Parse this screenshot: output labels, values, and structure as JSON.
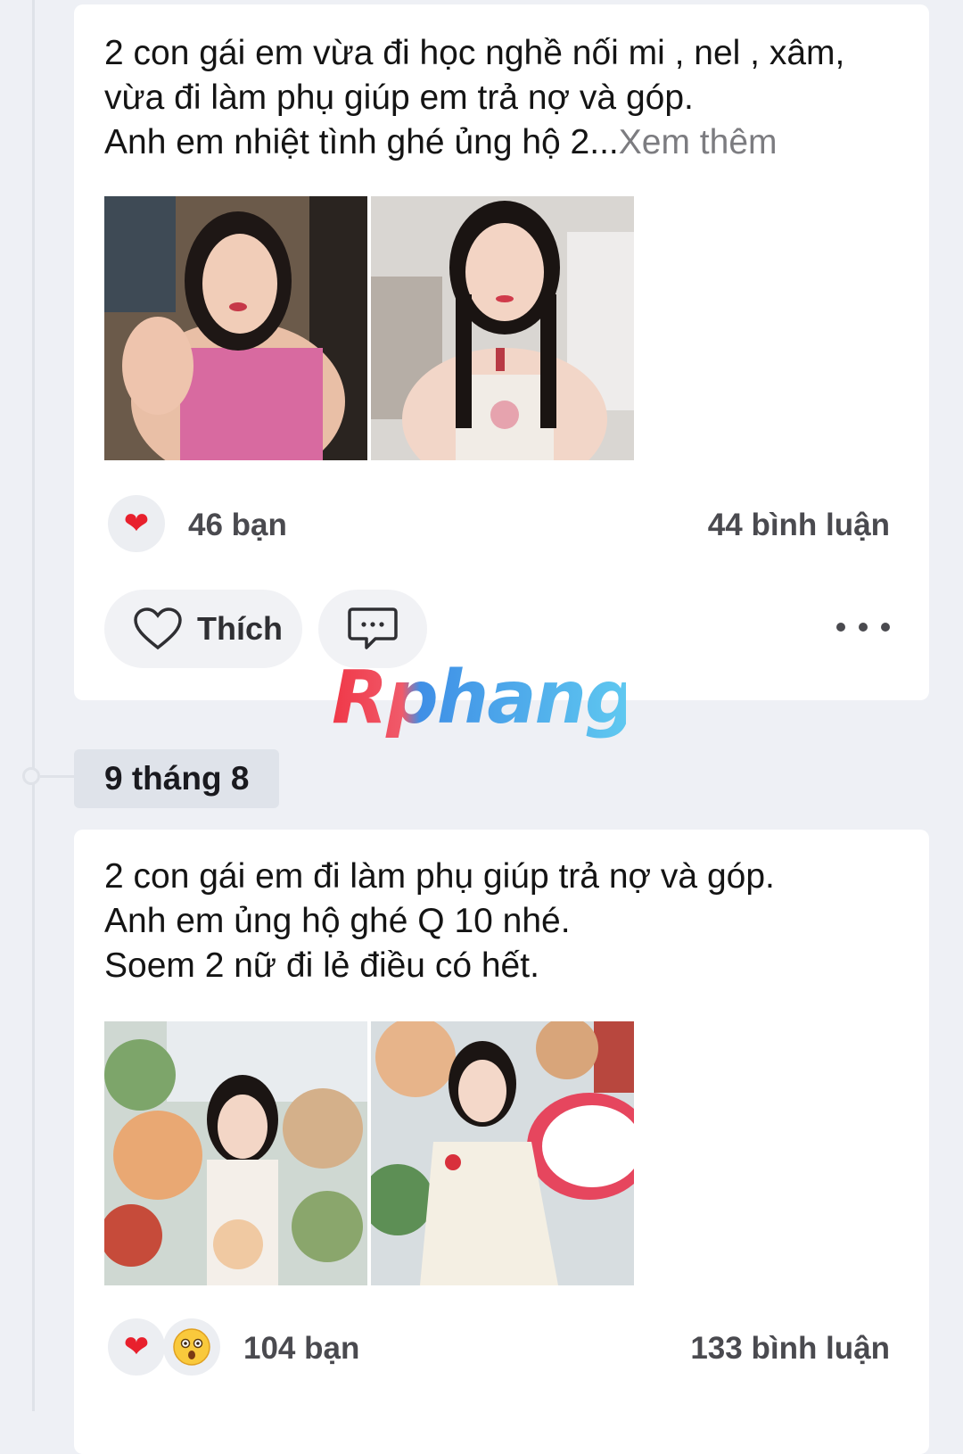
{
  "posts": [
    {
      "text": "2 con gái em vừa đi học nghề nối mi , nel , xâm,\nvừa đi làm phụ giúp em trả nợ và góp.\nAnh em nhiệt tình ghé ủng hộ 2...",
      "see_more": "Xem thêm",
      "reactions": [
        "heart-icon"
      ],
      "reaction_count": "46 bạn",
      "comment_count": "44 bình luận",
      "like_label": "Thích"
    },
    {
      "date": "9 tháng 8",
      "text": "2 con gái em đi làm phụ giúp trả nợ và góp.\nAnh em ủng hộ ghé Q 10 nhé.\nSoem 2 nữ đi lẻ điều có hết.",
      "reactions": [
        "heart-icon",
        "surprised-emoji-icon"
      ],
      "reaction_count": "104 bạn",
      "comment_count": "133 bình luận"
    }
  ],
  "watermark": "Rphang",
  "colors": {
    "background": "#eef0f5",
    "card": "#ffffff",
    "heart": "#e8202d",
    "secondary_text": "#7c7c80"
  }
}
